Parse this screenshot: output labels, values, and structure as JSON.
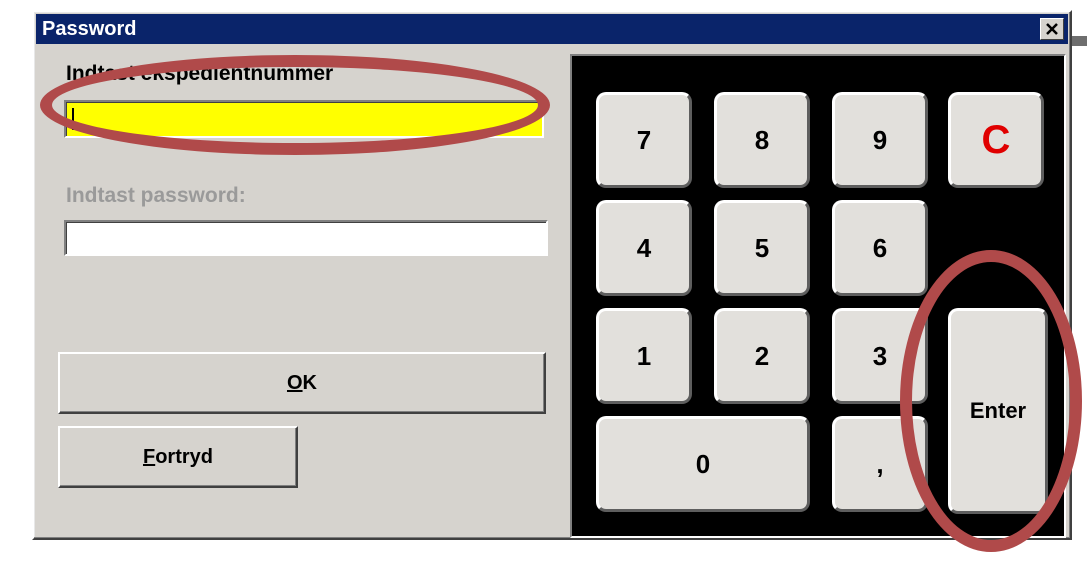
{
  "window": {
    "title": "Password",
    "close_icon": "close-icon"
  },
  "form": {
    "user_label": "Indtast ekspedientnummer",
    "user_value": "",
    "password_label": "Indtast password:",
    "password_value": ""
  },
  "buttons": {
    "ok_label": "OK",
    "ok_mnemonic": "O",
    "ok_rest": "K",
    "cancel_label": "Fortryd",
    "cancel_mnemonic": "F",
    "cancel_rest": "ortryd"
  },
  "keypad": {
    "key_7": "7",
    "key_8": "8",
    "key_9": "9",
    "key_clear": "C",
    "key_4": "4",
    "key_5": "5",
    "key_6": "6",
    "key_1": "1",
    "key_2": "2",
    "key_3": "3",
    "key_0": "0",
    "key_comma": ",",
    "key_enter": "Enter"
  },
  "colors": {
    "titlebar": "#0a246a",
    "active_field": "#ffff00",
    "clear_key_text": "#e00000",
    "annotation": "#b04a4a"
  }
}
